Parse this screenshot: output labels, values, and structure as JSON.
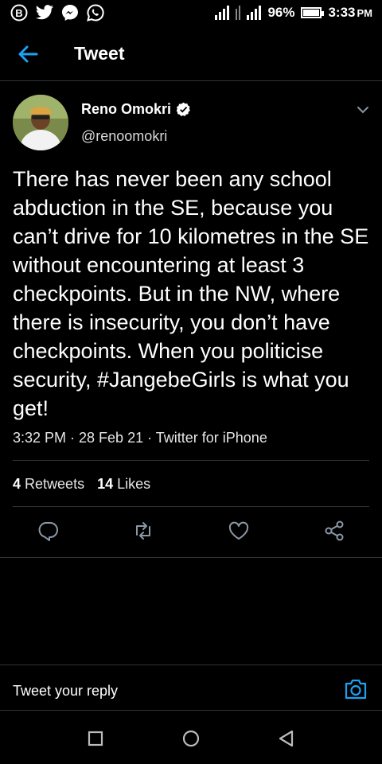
{
  "status_bar": {
    "icons_left": [
      "bitcoin-icon",
      "twitter-icon",
      "messenger-icon",
      "whatsapp-icon"
    ],
    "battery": "96%",
    "battery_level": 0.96,
    "time": "3:33",
    "time_suffix": "PM"
  },
  "header": {
    "title": "Tweet"
  },
  "tweet": {
    "author_name": "Reno Omokri",
    "handle": "@renoomokri",
    "text": "There has never been any school abduction in the SE, because you can’t drive for 10 kilometres in the SE without encountering at least 3 checkpoints. But in the NW, where there is insecurity, you don’t have checkpoints. When you politicise security, #JangebeGirls is what you get!",
    "timestamp": "3:32 PM · 28 Feb 21 · Twitter for iPhone",
    "retweets_count": "4",
    "retweets_label": "Retweets",
    "likes_count": "14",
    "likes_label": "Likes"
  },
  "reply": {
    "placeholder": "Tweet your reply"
  },
  "colors": {
    "accent": "#1da1f2",
    "background": "#000000",
    "divider": "#2f3336",
    "icon_gray": "#8b98a5"
  }
}
